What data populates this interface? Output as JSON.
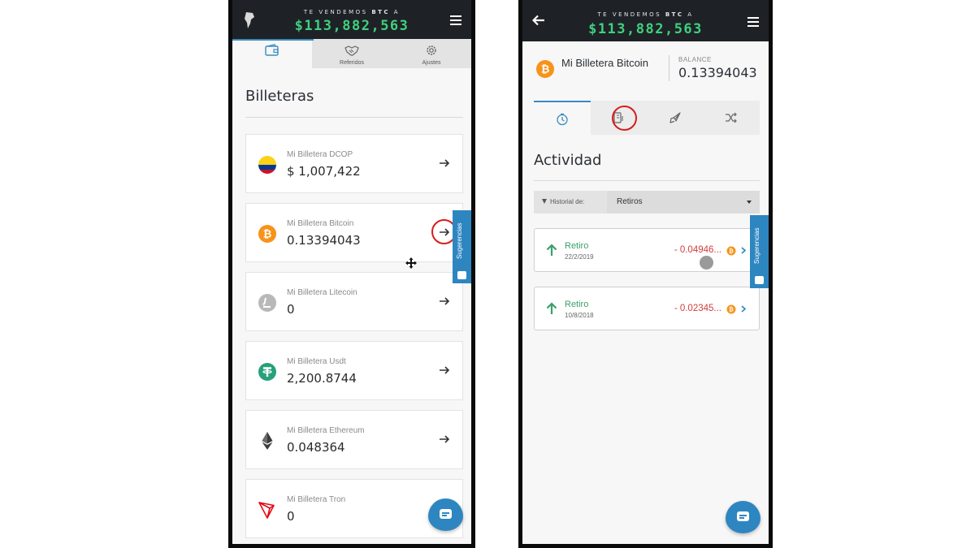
{
  "header": {
    "tagline_prefix": "TE VENDEMOS",
    "tagline_coin": "BTC",
    "tagline_suffix": "A",
    "btc_price": "$113,882,563"
  },
  "left_screen": {
    "tabs": [
      {
        "label": "",
        "icon": "wallet-icon"
      },
      {
        "label": "Referidos",
        "icon": "handshake-icon"
      },
      {
        "label": "Ajustes",
        "icon": "gear-icon"
      }
    ],
    "title": "Billeteras",
    "wallets": [
      {
        "name": "Mi Billetera DCOP",
        "value": "$ 1,007,422",
        "icon": "colombia-flag-icon"
      },
      {
        "name": "Mi Billetera Bitcoin",
        "value": "0.13394043",
        "icon": "bitcoin-icon"
      },
      {
        "name": "Mi Billetera Litecoin",
        "value": "0",
        "icon": "litecoin-icon"
      },
      {
        "name": "Mi Billetera Usdt",
        "value": "2,200.8744",
        "icon": "tether-icon"
      },
      {
        "name": "Mi Billetera Ethereum",
        "value": "0.048364",
        "icon": "ethereum-icon"
      },
      {
        "name": "Mi Billetera Tron",
        "value": "0",
        "icon": "tron-icon"
      }
    ],
    "suggestions_label": "Sugerencias"
  },
  "right_screen": {
    "wallet_title": "Mi Billetera Bitcoin",
    "balance_label": "BALANCE",
    "balance_value": "0.13394043",
    "tabs": [
      {
        "icon": "history-icon"
      },
      {
        "icon": "withdraw-icon"
      },
      {
        "icon": "send-rocket-icon"
      },
      {
        "icon": "swap-icon"
      }
    ],
    "section_title": "Actividad",
    "filter_label": "Historial de:",
    "filter_value": "Retiros",
    "transactions": [
      {
        "type": "Retiro",
        "date": "22/2/2019",
        "amount": "- 0.04946..."
      },
      {
        "type": "Retiro",
        "date": "10/8/2018",
        "amount": "- 0.02345..."
      }
    ],
    "suggestions_label": "Sugerencias"
  },
  "colors": {
    "topbar": "#1e2226",
    "price_green": "#3fd07f",
    "accent_blue": "#2e86c1",
    "highlight_red": "#d81c1c",
    "withdraw_green": "#3aa06b",
    "amount_red": "#d33d3d"
  }
}
